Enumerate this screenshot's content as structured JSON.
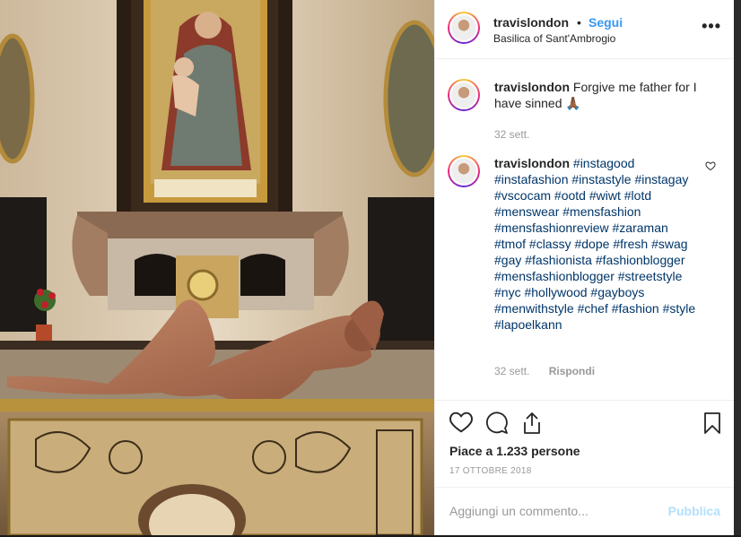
{
  "post": {
    "username": "travislondon",
    "dot": "•",
    "follow_label": "Segui",
    "location": "Basilica of Sant'Ambrogio",
    "more_icon": "more-icon"
  },
  "comments": [
    {
      "username": "travislondon",
      "text": "Forgive me father for I have sinned",
      "emoji": "🙏🏾",
      "time": "32 sett."
    },
    {
      "username": "travislondon",
      "hashtags": [
        "#instagood",
        "#instafashion",
        "#instastyle",
        "#instagay",
        "#vscocam",
        "#ootd",
        "#wiwt",
        "#lotd",
        "#menswear",
        "#mensfashion",
        "#mensfashionreview",
        "#zaraman",
        "#tmof",
        "#classy",
        "#dope",
        "#fresh",
        "#swag",
        "#gay",
        "#fashionista",
        "#fashionblogger",
        "#mensfashionblogger",
        "#streetstyle",
        "#nyc",
        "#hollywood",
        "#gayboys",
        "#menwithstyle",
        "#chef",
        "#fashion",
        "#style",
        "#lapoelkann"
      ],
      "time": "32 sett.",
      "reply_label": "Rispondi"
    }
  ],
  "actions": {
    "likes": "Piace a 1.233 persone",
    "date": "17 OTTOBRE 2018",
    "comment_placeholder": "Aggiungi un commento...",
    "publish_label": "Pubblica"
  },
  "colors": {
    "link": "#3897f0",
    "hashtag": "#003569",
    "muted": "#999999",
    "publish": "#b2dffc"
  }
}
